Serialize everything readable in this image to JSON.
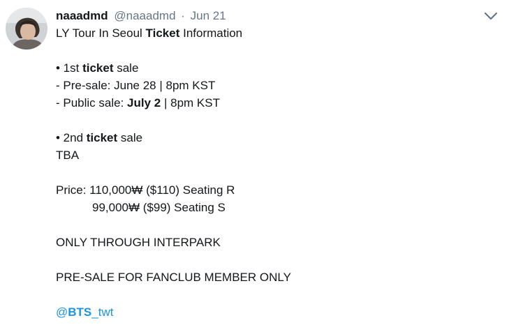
{
  "tweet": {
    "display_name": "naaadmd",
    "handle": "@naaadmd",
    "separator": "·",
    "time": "Jun 21",
    "title": {
      "a": "LY Tour In Seoul ",
      "b": "Ticket",
      "c": " Information"
    },
    "first_sale": {
      "a": "• 1st ",
      "b": "ticket",
      "c": " sale"
    },
    "pre_sale": "- Pre-sale: June 28 | 8pm KST",
    "public_sale": {
      "a": "- Public sale: ",
      "b": "July 2",
      "c": " | 8pm KST"
    },
    "second_sale": {
      "a": "• 2nd ",
      "b": "ticket",
      "c": " sale"
    },
    "tba": "TBA",
    "price_r": "Price: 110,000₩ ($110) Seating R",
    "price_s": "99,000₩ ($99) Seating S",
    "only_through": "ONLY THROUGH INTERPARK",
    "presale_note": "PRE-SALE FOR FANCLUB MEMBER ONLY",
    "mention": {
      "at": "@",
      "bold": "BTS",
      "rest": "_twt"
    }
  },
  "icons": {
    "avatar": "profile-photo",
    "more": "chevron-down-icon"
  },
  "colors": {
    "text": "#14171a",
    "secondary": "#657786",
    "link": "#1b95e0"
  }
}
